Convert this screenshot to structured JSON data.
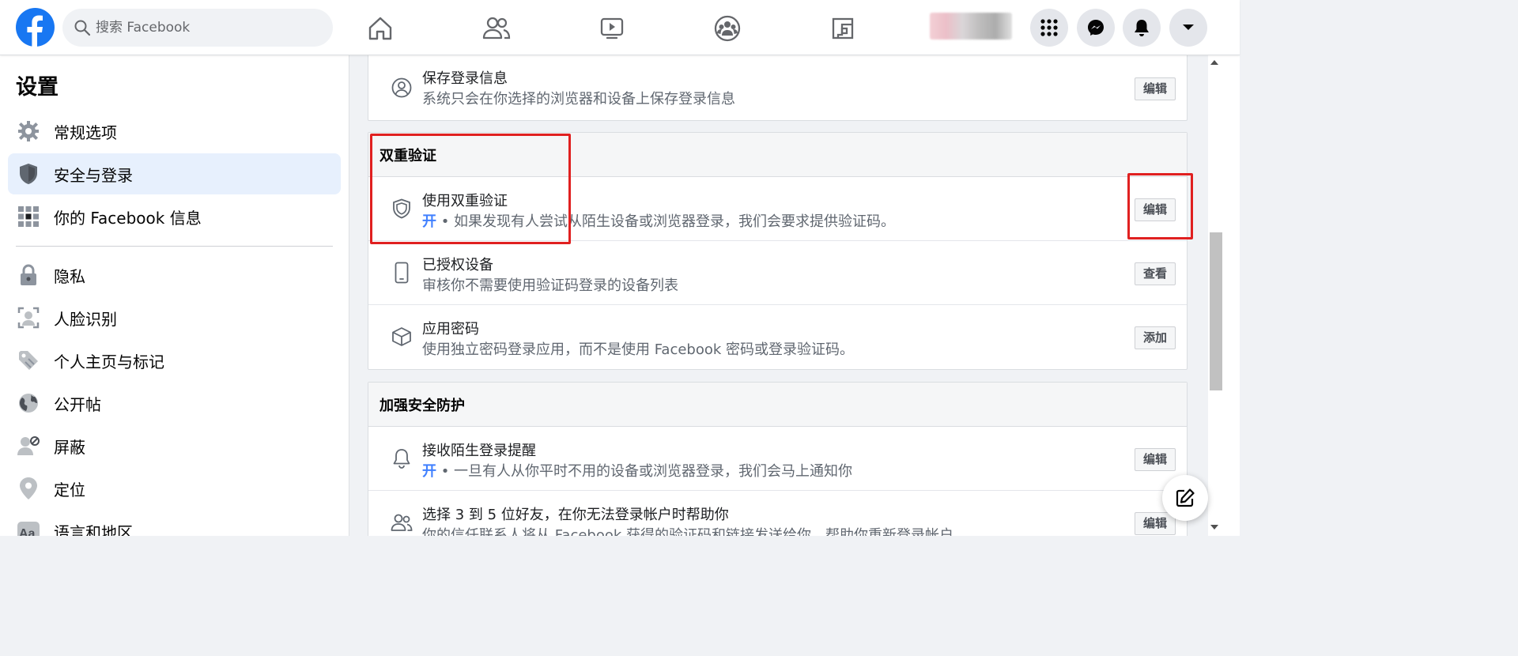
{
  "search": {
    "placeholder": "搜索 Facebook"
  },
  "nav": [
    "home-icon",
    "friends-icon",
    "watch-icon",
    "groups-icon",
    "gaming-icon"
  ],
  "sidebar": {
    "title": "设置",
    "items": [
      {
        "label": "常规选项",
        "icon": "gear-icon"
      },
      {
        "label": "安全与登录",
        "icon": "shield-icon",
        "active": true
      },
      {
        "label": "你的 Facebook 信息",
        "icon": "grid-icon"
      },
      {
        "label": "隐私",
        "icon": "lock-icon"
      },
      {
        "label": "人脸识别",
        "icon": "face-icon"
      },
      {
        "label": "个人主页与标记",
        "icon": "tag-icon"
      },
      {
        "label": "公开帖",
        "icon": "globe-icon"
      },
      {
        "label": "屏蔽",
        "icon": "block-user-icon"
      },
      {
        "label": "定位",
        "icon": "location-icon"
      },
      {
        "label": "语言和地区",
        "icon": "language-icon"
      }
    ]
  },
  "login_card": {
    "save_login": {
      "title": "保存登录信息",
      "desc": "系统只会在你选择的浏览器和设备上保存登录信息",
      "button": "编辑"
    }
  },
  "two_factor": {
    "header": "双重验证",
    "use_2fa": {
      "title": "使用双重验证",
      "status": "开",
      "desc": " • 如果发现有人尝试从陌生设备或浏览器登录，我们会要求提供验证码。",
      "button": "编辑"
    },
    "authorized": {
      "title": "已授权设备",
      "desc": "审核你不需要使用验证码登录的设备列表",
      "button": "查看"
    },
    "app_pw": {
      "title": "应用密码",
      "desc": "使用独立密码登录应用，而不是使用 Facebook 密码或登录验证码。",
      "button": "添加"
    }
  },
  "extra_security": {
    "header": "加强安全防护",
    "alerts": {
      "title": "接收陌生登录提醒",
      "status": "开",
      "desc": " • 一旦有人从你平时不用的设备或浏览器登录，我们会马上通知你",
      "button": "编辑"
    },
    "friends": {
      "title": "选择 3 到 5 位好友，在你无法登录帐户时帮助你",
      "desc": "你的信任联系人将从 Facebook 获得的验证码和链接发送给你，帮助你重新登录帐户",
      "button": "编辑"
    }
  },
  "colors": {
    "brand": "#1877f2",
    "active_bg": "#e7f0fd",
    "on": "#4080ff",
    "highlight": "#e02020"
  }
}
